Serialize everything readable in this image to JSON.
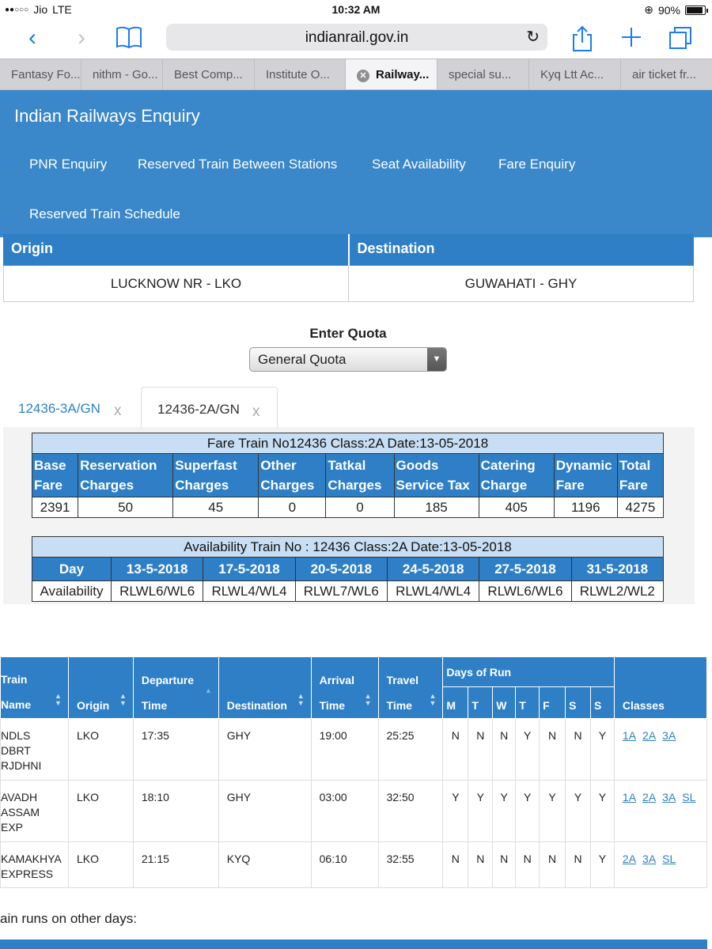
{
  "status": {
    "carrier": "Jio",
    "network": "LTE",
    "time": "10:32 AM",
    "battery": "90%"
  },
  "browser": {
    "url": "indianrail.gov.in",
    "tabs": [
      "Fantasy Fo...",
      "nithm - Go...",
      "Best Comp...",
      "Institute O...",
      "Railway...",
      "special su...",
      "Kyq Ltt Ac...",
      "air ticket fr..."
    ]
  },
  "site": {
    "title": "Indian Railways Enquiry",
    "nav": [
      "PNR Enquiry",
      "Reserved Train Between Stations",
      "Seat Availability",
      "Fare Enquiry",
      "Reserved Train Schedule"
    ]
  },
  "route": {
    "origin_label": "Origin",
    "destination_label": "Destination",
    "origin": "LUCKNOW NR - LKO",
    "destination": "GUWAHATI - GHY"
  },
  "quota": {
    "label": "Enter Quota",
    "value": "General Quota"
  },
  "fare_tabs": [
    {
      "label": "12436-3A/GN",
      "close": "x"
    },
    {
      "label": "12436-2A/GN",
      "close": "x"
    }
  ],
  "fare": {
    "caption": "Fare Train No12436  Class:2A  Date:13-05-2018",
    "headers": [
      [
        "Base",
        "Fare"
      ],
      [
        "Reservation",
        "Charges"
      ],
      [
        "Superfast",
        "Charges"
      ],
      [
        "Other",
        "Charges"
      ],
      [
        "Tatkal",
        "Charges"
      ],
      [
        "Goods",
        "Service Tax"
      ],
      [
        "Catering",
        "Charge"
      ],
      [
        "Dynamic",
        "Fare"
      ],
      [
        "Total",
        "Fare"
      ]
    ],
    "values": [
      "2391",
      "50",
      "45",
      "0",
      "0",
      "185",
      "405",
      "1196",
      "4275"
    ]
  },
  "availability": {
    "caption": "Availability Train No : 12436  Class:2A  Date:13-05-2018",
    "day_label": "Day",
    "row_label": "Availability",
    "dates": [
      "13-5-2018",
      "17-5-2018",
      "20-5-2018",
      "24-5-2018",
      "27-5-2018",
      "31-5-2018"
    ],
    "status": [
      "RLWL6/WL6",
      "RLWL4/WL4",
      "RLWL7/WL6",
      "RLWL4/WL4",
      "RLWL6/WL6",
      "RLWL2/WL2"
    ]
  },
  "trains": {
    "headers": {
      "name": [
        "Train",
        "Name"
      ],
      "origin": "Origin",
      "departure": [
        "Departure",
        "Time"
      ],
      "destination": "Destination",
      "arrival": [
        "Arrival",
        "Time"
      ],
      "travel": [
        "Travel",
        "Time"
      ],
      "days_of_run": "Days of Run",
      "days": [
        "M",
        "T",
        "W",
        "T",
        "F",
        "S",
        "S"
      ],
      "classes": "Classes"
    },
    "rows": [
      {
        "name": [
          "NDLS",
          "DBRT",
          "RJDHNI"
        ],
        "origin": "LKO",
        "departure": "17:35",
        "destination": "GHY",
        "arrival": "19:00",
        "travel": "25:25",
        "days": [
          "N",
          "N",
          "N",
          "Y",
          "N",
          "N",
          "Y"
        ],
        "classes": [
          "1A",
          "2A",
          "3A"
        ]
      },
      {
        "name": [
          "AVADH",
          "ASSAM",
          "EXP"
        ],
        "origin": "LKO",
        "departure": "18:10",
        "destination": "GHY",
        "arrival": "03:00",
        "travel": "32:50",
        "days": [
          "Y",
          "Y",
          "Y",
          "Y",
          "Y",
          "Y",
          "Y"
        ],
        "classes": [
          "1A",
          "2A",
          "3A",
          "SL"
        ]
      },
      {
        "name": [
          "KAMAKHYA",
          "EXPRESS"
        ],
        "origin": "LKO",
        "departure": "21:15",
        "destination": "KYQ",
        "arrival": "06:10",
        "travel": "32:55",
        "days": [
          "N",
          "N",
          "N",
          "N",
          "N",
          "N",
          "Y"
        ],
        "classes": [
          "2A",
          "3A",
          "SL"
        ]
      }
    ]
  },
  "other_days_note": "ain runs on other days:"
}
